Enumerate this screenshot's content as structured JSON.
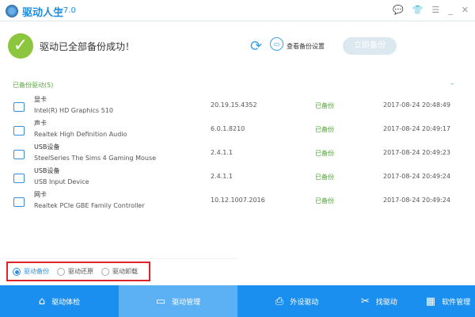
{
  "app": {
    "title": "驱动人生",
    "version": "v7.0"
  },
  "window_buttons": [
    "feedback",
    "skin",
    "menu",
    "minimize",
    "close"
  ],
  "status": {
    "message": "驱动已全部备份成功！",
    "view_settings": "查看备份设置",
    "backup_now": "立即备份"
  },
  "section": {
    "title": "已备份驱动(5)"
  },
  "drivers": [
    {
      "category": "显卡",
      "name": "Intel(R) HD Graphics 510",
      "version": "20.19.15.4352",
      "status": "已备份",
      "time": "2017-08-24 20:48:49",
      "icon": "display-card-icon"
    },
    {
      "category": "声卡",
      "name": "Realtek High Definition Audio",
      "version": "6.0.1.8210",
      "status": "已备份",
      "time": "2017-08-24 20:49:17",
      "icon": "speaker-icon"
    },
    {
      "category": "USB设备",
      "name": "SteelSeries The Sims 4 Gaming Mouse",
      "version": "2.4.1.1",
      "status": "已备份",
      "time": "2017-08-24 20:49:23",
      "icon": "usb-device-icon"
    },
    {
      "category": "USB设备",
      "name": "USB Input Device",
      "version": "2.4.1.1",
      "status": "已备份",
      "time": "2017-08-24 20:49:24",
      "icon": "usb-device-icon"
    },
    {
      "category": "网卡",
      "name": "Realtek PCIe GBE Family Controller",
      "version": "10.12.1007.2016",
      "status": "已备份",
      "time": "2017-08-24 20:49:24",
      "icon": "network-card-icon"
    }
  ],
  "modes": [
    {
      "label": "驱动备份",
      "selected": true
    },
    {
      "label": "驱动还原",
      "selected": false
    },
    {
      "label": "驱动卸载",
      "selected": false
    }
  ],
  "nav": [
    {
      "label": "驱动体检",
      "icon": "⌂"
    },
    {
      "label": "驱动管理",
      "icon": "▭",
      "active": true
    },
    {
      "label": "外设驱动",
      "icon": "⎙"
    },
    {
      "label": "找驱动",
      "icon": "✂"
    },
    {
      "label": "软件管理",
      "icon": "▦"
    }
  ],
  "colors": {
    "accent": "#1a8ff0",
    "success": "#8cc63f",
    "highlight": "#e0222a"
  }
}
